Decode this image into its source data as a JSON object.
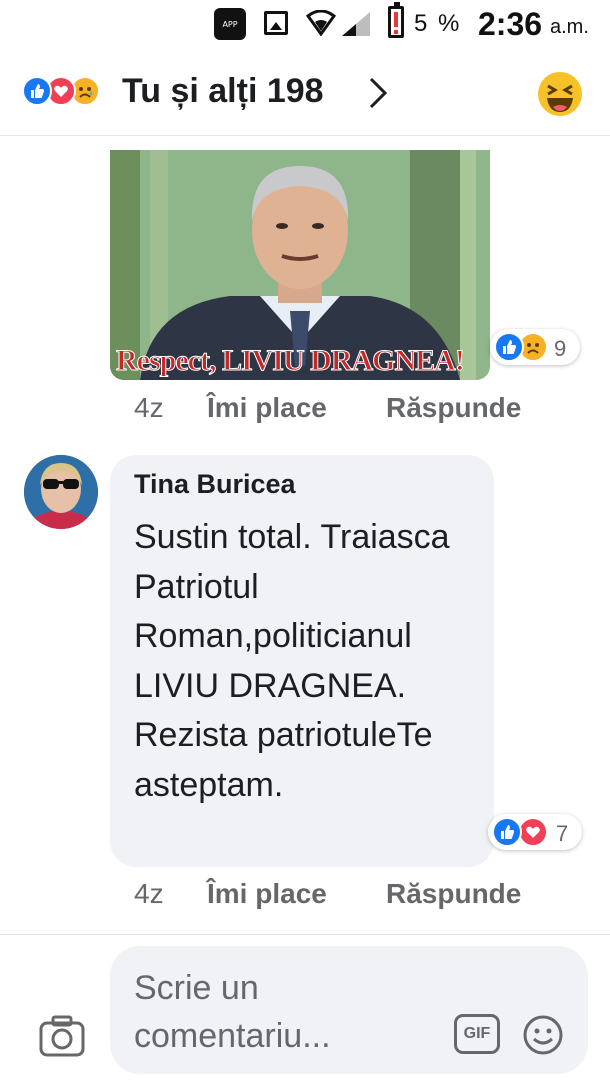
{
  "status_bar": {
    "app_icon_label": "APP",
    "battery_percent": "5 %",
    "time": "2:36",
    "ampm": "a.m.",
    "icons": [
      "app-icon",
      "gallery-icon",
      "wifi-icon",
      "signal-icon",
      "battery-low-icon"
    ]
  },
  "header": {
    "reactions": [
      "like-reaction-icon",
      "love-reaction-icon",
      "sad-reaction-icon"
    ],
    "title": "Tu și alți 198",
    "right_icon": "haha-reaction-icon"
  },
  "post_image": {
    "caption": "Respect, LIVIU DRAGNEA!",
    "reaction_count": "9",
    "reactions": [
      "like-reaction-icon",
      "sad-reaction-icon"
    ]
  },
  "image_comment_actions": {
    "time": "4z",
    "like": "Îmi place",
    "reply": "Răspunde"
  },
  "comment": {
    "author": "Tina Buricea",
    "text": "Sustin total. Traiasca Patriotul Roman,politicianul LIVIU DRAGNEA. Rezista patriotuleTe asteptam.",
    "reaction_count": "7",
    "reactions": [
      "like-reaction-icon",
      "love-reaction-icon"
    ],
    "time": "4z",
    "like": "Îmi place",
    "reply": "Răspunde"
  },
  "composer": {
    "placeholder": "Scrie un comentariu...",
    "gif_label": "GIF"
  },
  "colors": {
    "like_blue": "#1877f2",
    "love_red": "#f33e58",
    "sad_yellow": "#f7b125",
    "meta_gray": "#65676b",
    "bubble_bg": "#f0f2f5"
  }
}
